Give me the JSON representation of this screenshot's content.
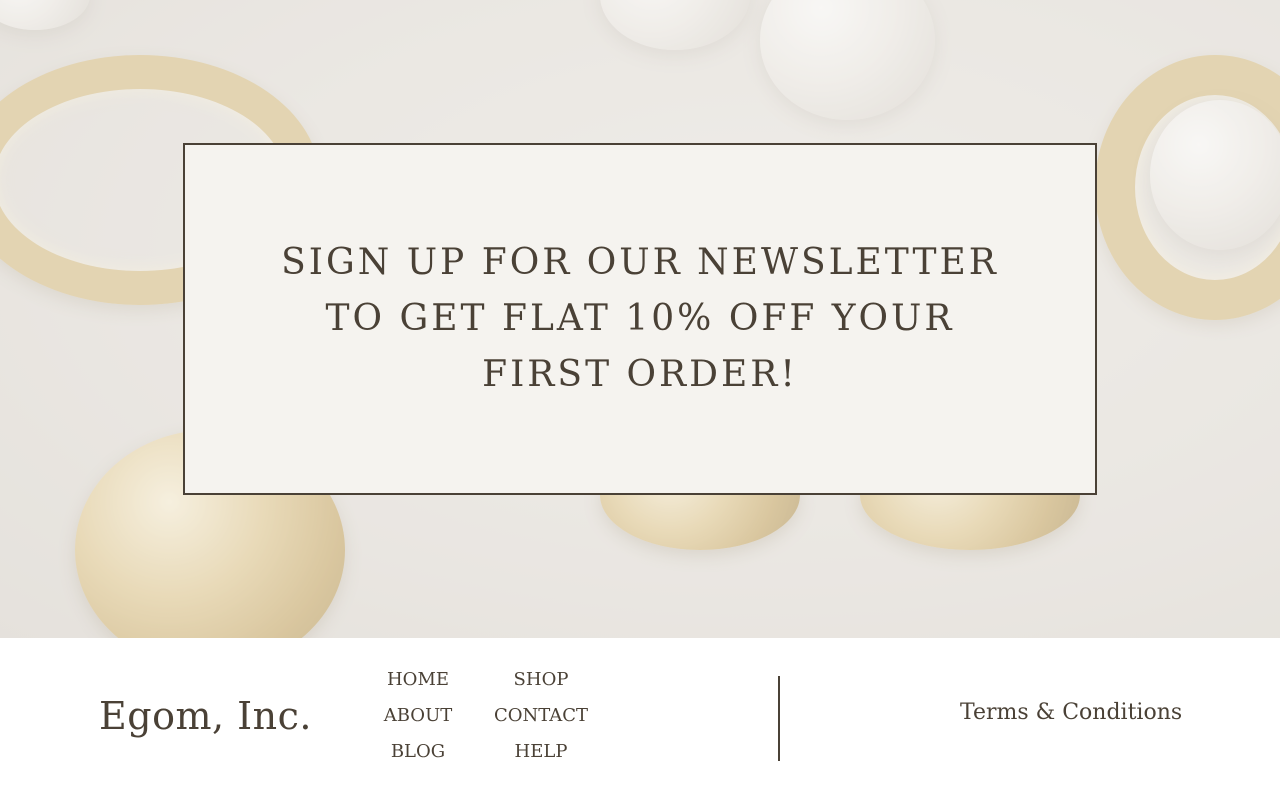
{
  "hero": {
    "background_icon": "jewelry-photo",
    "newsletter_text": "SIGN UP FOR OUR NEWSLETTER TO GET FLAT 10% OFF YOUR FIRST ORDER!"
  },
  "footer": {
    "brand": "Egom, Inc.",
    "nav": [
      {
        "label": "HOME"
      },
      {
        "label": "SHOP"
      },
      {
        "label": "ABOUT"
      },
      {
        "label": "CONTACT"
      },
      {
        "label": "BLOG"
      },
      {
        "label": "HELP"
      }
    ],
    "terms_label": "Terms & Conditions"
  },
  "colors": {
    "text": "#4a4136",
    "card_bg": "#f5f3ef",
    "page_bg": "#ffffff"
  }
}
